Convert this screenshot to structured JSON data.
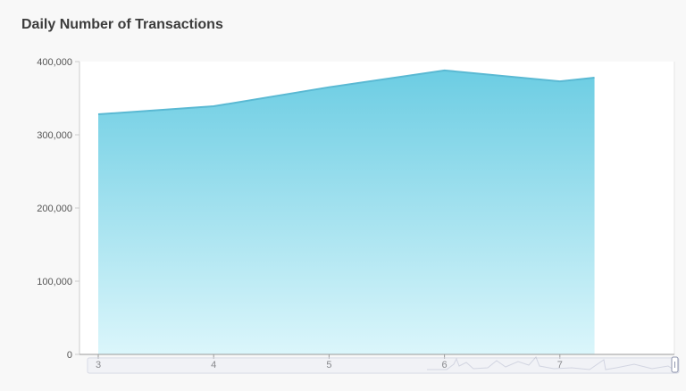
{
  "chart_data": {
    "type": "area",
    "title": "Daily Number of Transactions",
    "x": [
      "3",
      "4",
      "5",
      "6",
      "7",
      "7.3"
    ],
    "x_ticks": [
      "3",
      "4",
      "5",
      "6",
      "7"
    ],
    "series": [
      {
        "values": [
          328000,
          339000,
          365000,
          388000,
          373000,
          378000
        ]
      }
    ],
    "y_ticks": [
      "0",
      "100,000",
      "200,000",
      "300,000",
      "400,000"
    ],
    "ylim": [
      0,
      400000
    ],
    "grid": false,
    "legend": "none",
    "fill_color_top": "#6ccde3",
    "fill_color_bottom": "#dbf6fb",
    "line_color": "#5ab9d3",
    "slider_color": "#e6e9f4"
  }
}
